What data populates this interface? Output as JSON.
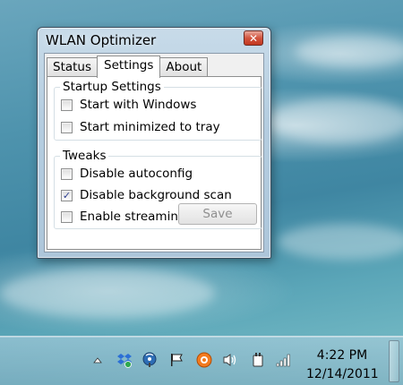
{
  "window": {
    "title": "WLAN Optimizer",
    "close_glyph": "✕"
  },
  "tabs": [
    {
      "label": "Status",
      "active": false
    },
    {
      "label": "Settings",
      "active": true
    },
    {
      "label": "About",
      "active": false
    }
  ],
  "startup_group": {
    "label": "Startup Settings",
    "items": [
      {
        "label": "Start with Windows",
        "checked": false
      },
      {
        "label": "Start minimized to tray",
        "checked": false
      }
    ]
  },
  "tweaks_group": {
    "label": "Tweaks",
    "items": [
      {
        "label": "Disable autoconfig",
        "checked": false
      },
      {
        "label": "Disable background scan",
        "checked": true
      },
      {
        "label": "Enable streaming mode",
        "checked": false
      }
    ]
  },
  "save_button": {
    "label": "Save",
    "enabled": false
  },
  "checkmark": "✓",
  "taskbar": {
    "clock_time": "4:22 PM",
    "clock_date": "12/14/2011",
    "tray_icons": [
      "show-hidden-icons-icon",
      "dropbox-icon",
      "wireless-network-icon",
      "action-center-flag-icon",
      "avast-icon",
      "volume-icon",
      "power-icon",
      "signal-bars-icon"
    ]
  },
  "colors": {
    "close_button": "#c2371f",
    "check": "#2a3b8f",
    "disabled_text": "#8f8f8f"
  }
}
